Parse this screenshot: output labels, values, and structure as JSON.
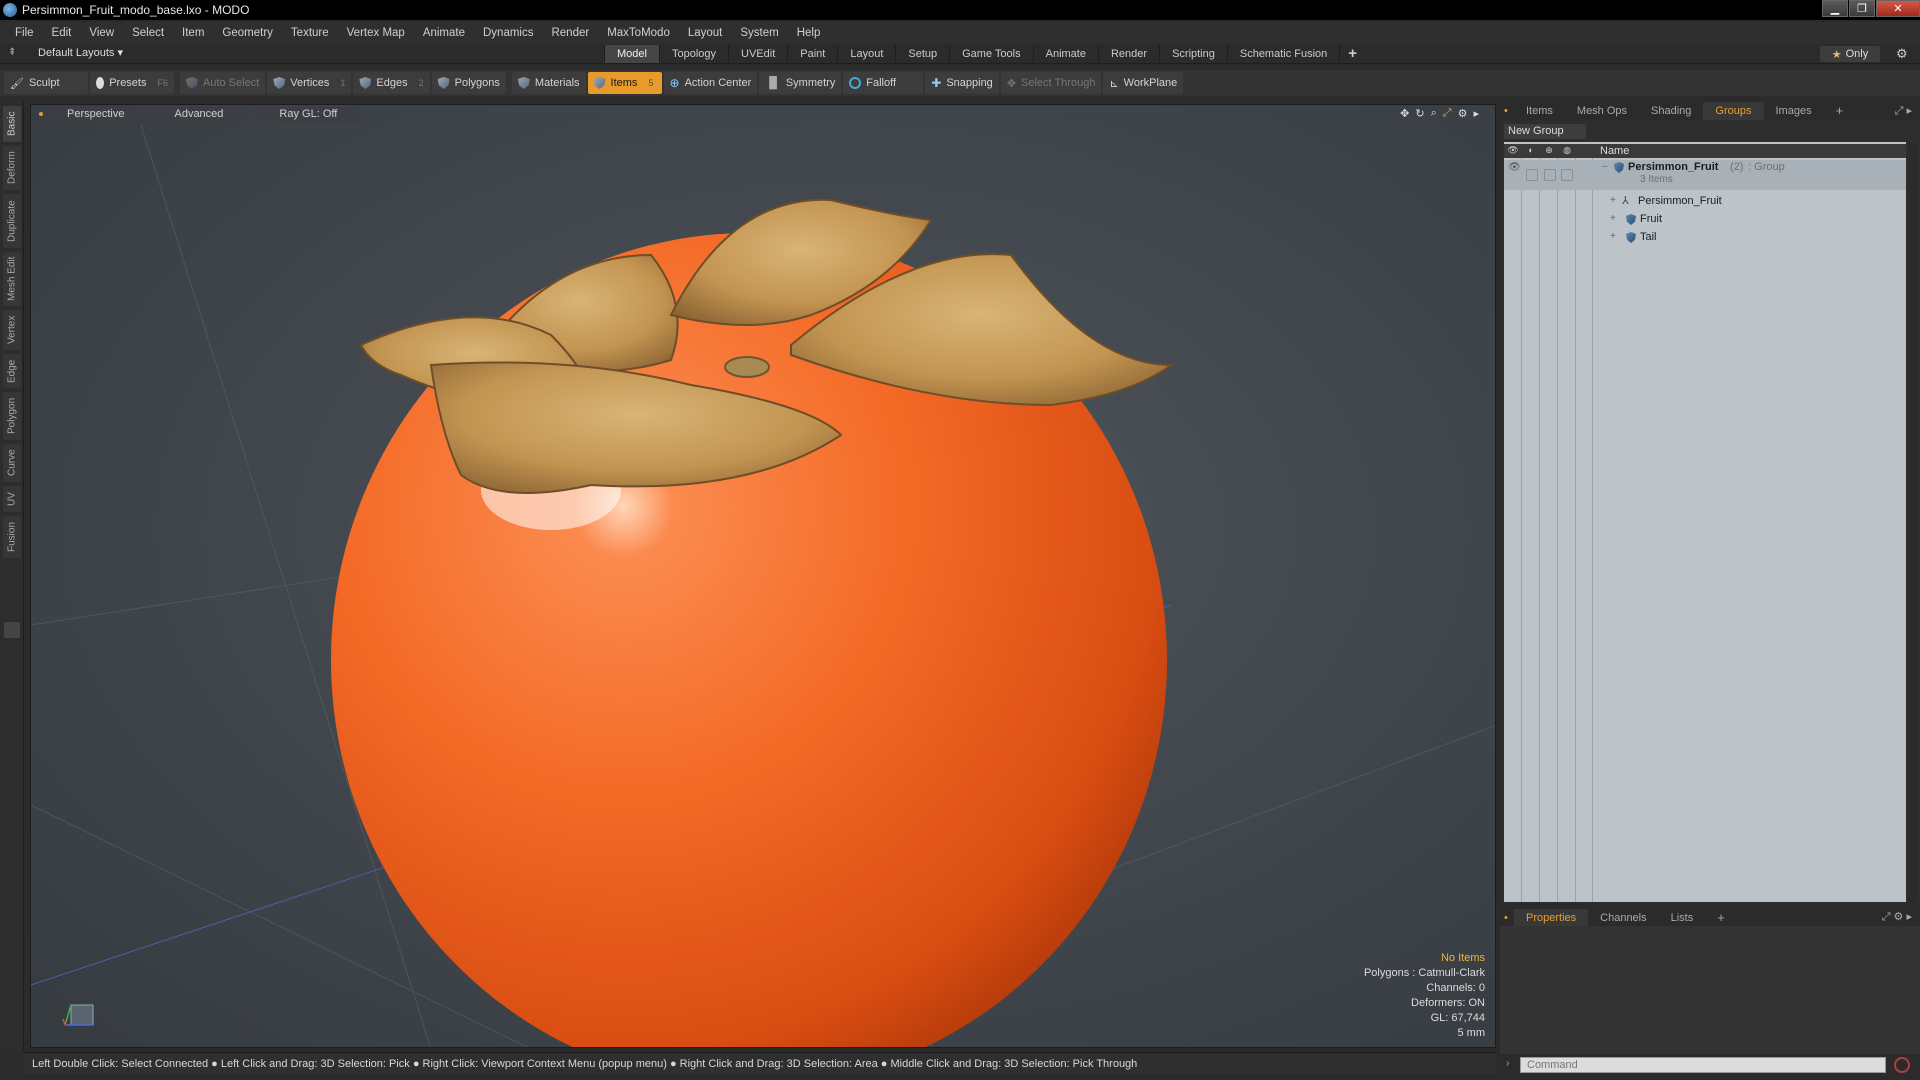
{
  "window": {
    "title": "Persimmon_Fruit_modo_base.lxo - MODO",
    "minimize": "▁",
    "maximize": "❐",
    "close": "✕"
  },
  "menu": [
    "File",
    "Edit",
    "View",
    "Select",
    "Item",
    "Geometry",
    "Texture",
    "Vertex Map",
    "Animate",
    "Dynamics",
    "Render",
    "MaxToModo",
    "Layout",
    "System",
    "Help"
  ],
  "layout_bar": {
    "layouts_dropdown": "Default Layouts ▾",
    "tabs": [
      "Model",
      "Topology",
      "UVEdit",
      "Paint",
      "Layout",
      "Setup",
      "Game Tools",
      "Animate",
      "Render",
      "Scripting",
      "Schematic Fusion"
    ],
    "active_tab": "Model",
    "plus": "+",
    "only_label": "Only",
    "only_star": "★"
  },
  "toolbar": {
    "sculpt": "Sculpt",
    "presets": "Presets",
    "presets_key": "F6",
    "auto_select": "Auto Select",
    "vertices": "Vertices",
    "vertices_key": "1",
    "edges": "Edges",
    "edges_key": "2",
    "polygons": "Polygons",
    "materials": "Materials",
    "items": "Items",
    "items_key": "5",
    "action_center": "Action Center",
    "symmetry": "Symmetry",
    "falloff": "Falloff",
    "snapping": "Snapping",
    "select_through": "Select Through",
    "workplane": "WorkPlane"
  },
  "left_rail": [
    "Basic",
    "Deform",
    "Duplicate",
    "Mesh Edit",
    "Vertex",
    "Edge",
    "Polygon",
    "Curve",
    "UV",
    "Fusion"
  ],
  "viewport": {
    "view_mode": "Perspective",
    "shading": "Advanced",
    "raygl": "Ray GL: Off",
    "info": {
      "no_items": "No Items",
      "polygons": "Polygons : Catmull-Clark",
      "channels": "Channels: 0",
      "deformers": "Deformers: ON",
      "gl": "GL: 67,744",
      "scale": "5 mm"
    }
  },
  "statusbar": "Left Double Click: Select Connected ● Left Click and Drag: 3D Selection: Pick ● Right Click: Viewport Context Menu (popup menu) ● Right Click and Drag: 3D Selection: Area ● Middle Click and Drag: 3D Selection: Pick Through",
  "right_panel": {
    "tabs": [
      "Items",
      "Mesh Ops",
      "Shading",
      "Groups",
      "Images"
    ],
    "active_tab": "Groups",
    "plus": "+",
    "new_group": "New Group",
    "name_header": "Name",
    "group": {
      "name": "Persimmon_Fruit",
      "count": "(2)",
      "type": ": Group",
      "subtitle": "3 Items"
    },
    "children": [
      "Persimmon_Fruit",
      "Fruit",
      "Tail"
    ]
  },
  "props_panel": {
    "tabs": [
      "Properties",
      "Channels",
      "Lists"
    ],
    "active_tab": "Properties",
    "plus": "+"
  },
  "command": {
    "placeholder": "Command"
  }
}
